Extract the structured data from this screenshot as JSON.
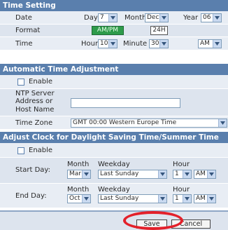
{
  "time_setting": {
    "header": "Time Setting",
    "date_label": "Date",
    "day_label": "Day",
    "day_value": "7",
    "month_label": "Month",
    "month_value": "Dec",
    "year_label": "Year",
    "year_value": "06",
    "format_label": "Format",
    "format_ampm": "AM/PM",
    "format_24h": "24H",
    "time_label": "Time",
    "hour_label": "Hour",
    "hour_value": "10",
    "minute_label": "Minute",
    "minute_value": "30",
    "ampm_value": "AM"
  },
  "auto_adjust": {
    "header": "Automatic Time Adjustment",
    "enable_label": "Enable",
    "enable_checked": false,
    "ntp_label_1": "NTP Server",
    "ntp_label_2": "Address or",
    "ntp_label_3": "Host Name",
    "ntp_value": "",
    "timezone_label": "Time Zone",
    "timezone_value": "GMT 00:00 Western Europe Time"
  },
  "dst": {
    "header": "Adjust Clock for Daylight Saving Time/Summer Time",
    "enable_label": "Enable",
    "enable_checked": false,
    "start_label": "Start Day:",
    "end_label": "End Day:",
    "month_col": "Month",
    "weekday_col": "Weekday",
    "hour_col": "Hour",
    "start_month": "Mar",
    "start_weekday": "Last Sunday",
    "start_hour": "1",
    "start_ampm": "AM",
    "end_month": "Oct",
    "end_weekday": "Last Sunday",
    "end_hour": "1",
    "end_ampm": "AM"
  },
  "actions": {
    "save_label": "Save",
    "cancel_label": "Cancel"
  },
  "colors": {
    "header_bg": "#5a7fad",
    "row_bg": "#e8edf4",
    "format_active_bg": "#2e9b4b",
    "highlight_circle": "#e3202a"
  }
}
